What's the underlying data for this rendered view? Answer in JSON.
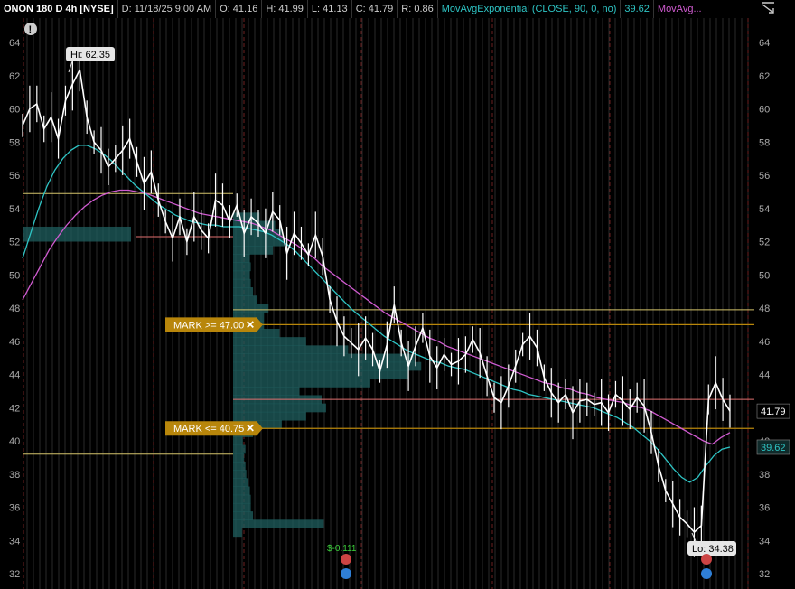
{
  "header": {
    "symbol": "ONON 180 D 4h [NYSE]",
    "date": "D: 11/18/25 9:00 AM",
    "open": "O: 41.16",
    "high": "H: 41.99",
    "low": "L: 41.13",
    "close": "C: 41.79",
    "range": "R: 0.86",
    "study1": "MovAvgExponential (CLOSE, 90, 0, no)",
    "study1_value": "39.62",
    "study2": "MovAvg..."
  },
  "icons": {
    "alert": "alert-icon",
    "expand": "expand-icon",
    "earnings": "earnings-icon",
    "dividend": "dividend-icon"
  },
  "colors": {
    "price": "#ffffff",
    "ema": "#2ec4c4",
    "sma": "#d05bd0",
    "order": "#b8860b",
    "volume_profile": "#1f5f5f",
    "bg": "#000000"
  },
  "annotations": {
    "hi_label": "Hi: 62.35",
    "lo_label": "Lo: 34.38",
    "dividend_label": "$-0.111",
    "alert_mark": "!"
  },
  "orders": [
    {
      "label": "MARK >= 47.00",
      "price": 47.0
    },
    {
      "label": "MARK <= 40.75",
      "price": 40.75
    }
  ],
  "price_labels": {
    "last": "41.79",
    "ema": "39.62"
  },
  "chart_data": {
    "type": "line",
    "title": "ONON 180 D 4h [NYSE]",
    "ylim": [
      31,
      65.5
    ],
    "yticks": [
      32,
      34,
      36,
      38,
      40,
      42,
      44,
      46,
      48,
      50,
      52,
      54,
      56,
      58,
      60,
      62,
      64
    ],
    "grid": true,
    "series": [
      {
        "name": "Price",
        "values": [
          59,
          60,
          60.3,
          58.8,
          59.5,
          58.2,
          60.5,
          61.5,
          62.35,
          59.5,
          58,
          57.5,
          56.5,
          57,
          57.5,
          58.2,
          56.8,
          55.5,
          56.2,
          54.5,
          53.2,
          52.2,
          53.5,
          52,
          53.5,
          52.7,
          52.2,
          54.5,
          54.2,
          53.2,
          54.2,
          52.5,
          53.5,
          53.1,
          52.5,
          53.8,
          53.3,
          51.3,
          52.5,
          51.9,
          51.2,
          52.4,
          51.1,
          48.5,
          47.2,
          46.3,
          45.9,
          45.5,
          46.2,
          45.5,
          44.2,
          45.8,
          48.2,
          45.9,
          44.5,
          45.7,
          46.8,
          45.1,
          44.4,
          45.2,
          44.6,
          44.8,
          45.2,
          46.1,
          45.3,
          43.9,
          42.6,
          42.3,
          43.3,
          44.5,
          45.8,
          46.3,
          45.6,
          43.8,
          42.9,
          42.3,
          42.8,
          41.7,
          42.4,
          42.5,
          42.2,
          42.3,
          41.7,
          42.8,
          42.4,
          41.9,
          42.6,
          42.1,
          40.5,
          38.5,
          37,
          36.2,
          35.4,
          35,
          34.5,
          34.9,
          42.5,
          43.5,
          42.5,
          41.79
        ]
      },
      {
        "name": "MovAvgExponential (CLOSE, 90, 0, no)",
        "values": [
          51,
          52.5,
          54,
          55.3,
          56.3,
          57,
          57.5,
          57.8,
          57.8,
          57.6,
          57.3,
          56.9,
          56.4,
          55.9,
          55.4,
          55,
          54.6,
          54.2,
          53.9,
          53.6,
          53.4,
          53.2,
          53.1,
          53,
          53,
          52.9,
          52.9,
          52.9,
          52.8,
          52.7,
          52.6,
          52.4,
          52.1,
          51.8,
          51.4,
          50.9,
          50.4,
          49.9,
          49.4,
          48.9,
          48.4,
          47.9,
          47.5,
          47.1,
          46.7,
          46.3,
          46,
          45.7,
          45.4,
          45.2,
          45,
          44.8,
          44.7,
          44.5,
          44.4,
          44.3,
          44.1,
          43.9,
          43.7,
          43.5,
          43.3,
          43.1,
          43,
          42.8,
          42.7,
          42.6,
          42.5,
          42.4,
          42.3,
          42.2,
          42.1,
          42,
          41.8,
          41.6,
          41.4,
          41.1,
          40.8,
          40.4,
          40,
          39.5,
          38.9,
          38.3,
          37.8,
          37.5,
          37.8,
          38.5,
          39.1,
          39.5,
          39.62
        ]
      },
      {
        "name": "MovAvg",
        "values": [
          48.5,
          49.5,
          50.5,
          51.5,
          52.3,
          53,
          53.6,
          54.1,
          54.5,
          54.8,
          55,
          55.1,
          55.1,
          55,
          54.9,
          54.7,
          54.5,
          54.3,
          54.1,
          53.9,
          53.7,
          53.6,
          53.5,
          53.4,
          53.3,
          53.2,
          53.1,
          52.9,
          52.7,
          52.4,
          52.1,
          51.8,
          51.4,
          51,
          50.5,
          50.1,
          49.7,
          49.3,
          48.9,
          48.5,
          48.1,
          47.7,
          47.4,
          47.1,
          46.8,
          46.5,
          46.2,
          46,
          45.7,
          45.5,
          45.3,
          45.1,
          44.9,
          44.7,
          44.5,
          44.3,
          44.1,
          43.9,
          43.7,
          43.5,
          43.4,
          43.2,
          43.1,
          42.9,
          42.8,
          42.6,
          42.5,
          42.4,
          42.3,
          42.1,
          42,
          41.8,
          41.5,
          41.2,
          40.9,
          40.6,
          40.3,
          40,
          39.8,
          40.2,
          40.5
        ]
      }
    ],
    "levels": [
      54.9,
      39.2,
      52.3,
      47.9,
      42.5
    ],
    "volume_profile": {
      "price_bins": [
        34.5,
        35,
        35.5,
        36,
        36.5,
        37,
        37.5,
        38,
        38.5,
        39,
        39.5,
        40,
        40.5,
        41,
        41.5,
        42,
        42.5,
        43,
        43.5,
        44,
        44.5,
        45,
        45.5,
        46,
        46.5,
        47,
        47.5,
        48,
        48.5,
        49,
        49.5,
        50,
        50.5,
        51,
        51.5,
        52,
        52.5,
        53,
        53.5
      ],
      "volumes": [
        20,
        205,
        45,
        40,
        40,
        38,
        35,
        30,
        28,
        25,
        28,
        22,
        45,
        110,
        165,
        210,
        200,
        150,
        310,
        395,
        425,
        410,
        260,
        165,
        105,
        70,
        70,
        80,
        55,
        45,
        40,
        38,
        40,
        38,
        90,
        120,
        110,
        95,
        60
      ]
    },
    "markers": [
      {
        "type": "earnings",
        "index": 50
      },
      {
        "type": "dividend",
        "index": 50
      },
      {
        "type": "earnings",
        "index": 100
      },
      {
        "type": "dividend",
        "index": 100
      }
    ]
  }
}
